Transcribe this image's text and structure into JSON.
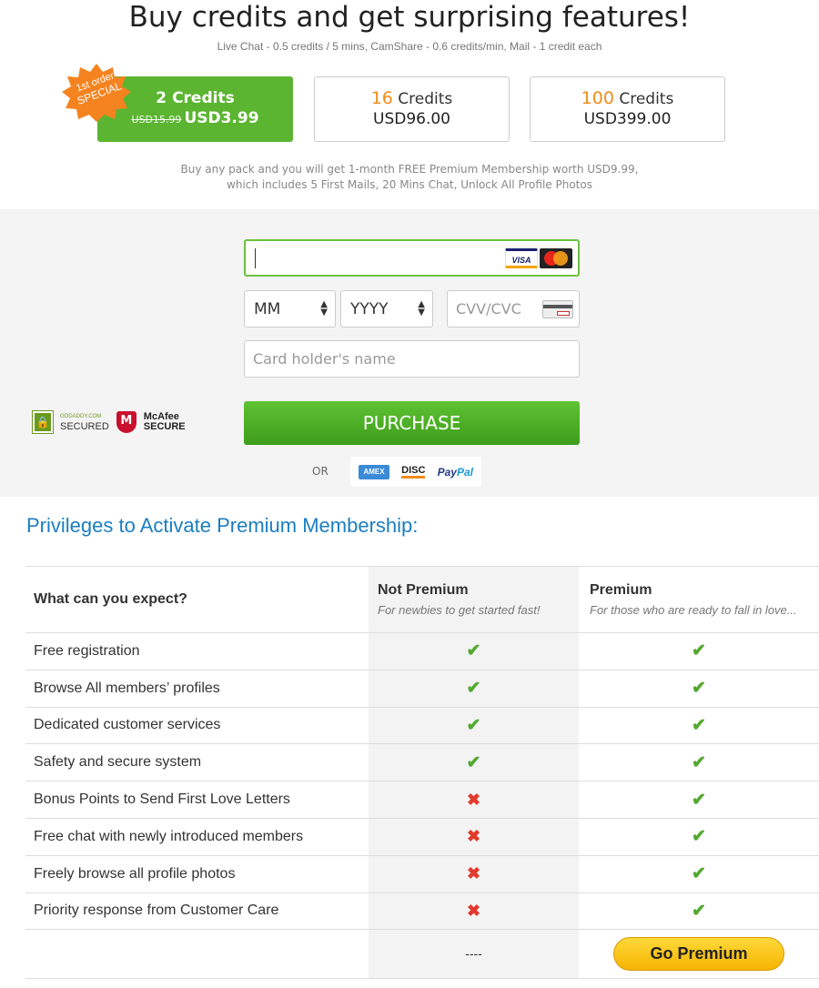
{
  "header": {
    "title": "Buy credits and get surprising features!",
    "subtitle": "Live Chat - 0.5 credits / 5 mins, CamShare - 0.6 credits/min, Mail - 1 credit each"
  },
  "badge": {
    "line1": "1st order",
    "line2": "SPECIAL"
  },
  "packs": [
    {
      "count": "2",
      "unit": "Credits",
      "old_price": "USD15.99",
      "price": "USD3.99",
      "selected": true
    },
    {
      "count": "16",
      "unit": "Credits",
      "price": "USD96.00"
    },
    {
      "count": "100",
      "unit": "Credits",
      "price": "USD399.00"
    }
  ],
  "membership_note": {
    "line1": "Buy any pack and you will get 1-month FREE Premium Membership worth USD9.99,",
    "line2": "which includes 5 First Mails, 20 Mins Chat, Unlock All Profile Photos"
  },
  "payment_form": {
    "card_number_value": "",
    "card_brands": [
      "VISA",
      "MasterCard"
    ],
    "month_value": "MM",
    "year_value": "YYYY",
    "cvv_placeholder": "CVV/CVC",
    "holder_placeholder": "Card holder's name",
    "purchase_label": "PURCHASE",
    "or_label": "OR",
    "alt_methods": {
      "amex": "AMEX",
      "discover": "DISC",
      "paypal_a": "Pay",
      "paypal_b": "Pal"
    }
  },
  "trust_badges": {
    "godaddy_small": "GODADDY.COM",
    "godaddy_label": "SECURED",
    "mcafee_name": "McAfee",
    "mcafee_label": "SECURE"
  },
  "privileges": {
    "title": "Privileges to Activate Premium Membership:",
    "columns": {
      "feature": "What can you expect?",
      "not_premium": "Not Premium",
      "not_premium_sub": "For newbies to get started fast!",
      "premium": "Premium",
      "premium_sub": "For those who are ready to fall in love..."
    },
    "rows": [
      {
        "feature": "Free registration",
        "not_premium": "✔",
        "premium": "✔"
      },
      {
        "feature": "Browse All members’ profiles",
        "not_premium": "✔",
        "premium": "✔"
      },
      {
        "feature": "Dedicated customer services",
        "not_premium": "✔",
        "premium": "✔"
      },
      {
        "feature": "Safety and secure system",
        "not_premium": "✔",
        "premium": "✔"
      },
      {
        "feature": "Bonus Points to Send First Love Letters",
        "not_premium": "✖",
        "premium": "✔"
      },
      {
        "feature": "Free chat with newly introduced members",
        "not_premium": "✖",
        "premium": "✔"
      },
      {
        "feature": "Freely browse all profile photos",
        "not_premium": "✖",
        "premium": "✔"
      },
      {
        "feature": "Priority response from Customer Care",
        "not_premium": "✖",
        "premium": "✔"
      }
    ],
    "footer": {
      "not_premium": "----",
      "premium_button": "Go Premium"
    }
  },
  "colors": {
    "accent_green": "#5cb531",
    "title_blue": "#1b7ec2",
    "orange": "#f08c1c",
    "check_green": "#53a92f",
    "cross_red": "#e23a2c",
    "button_yellow": "#f6b400"
  }
}
